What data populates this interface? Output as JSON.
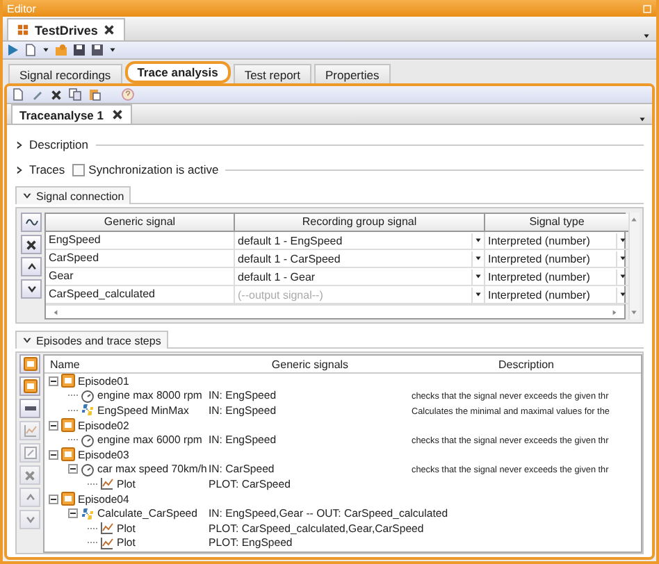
{
  "window": {
    "title": "Editor"
  },
  "document_tab": {
    "label": "TestDrives"
  },
  "main_tabs": [
    {
      "label": "Signal recordings",
      "selected": false
    },
    {
      "label": "Trace analysis",
      "selected": true
    },
    {
      "label": "Test report",
      "selected": false
    },
    {
      "label": "Properties",
      "selected": false
    }
  ],
  "analysis_tab": {
    "label": "Traceanalyse 1"
  },
  "description_section": {
    "label": "Description",
    "expanded": false
  },
  "traces_section": {
    "label": "Traces",
    "expanded": false,
    "sync_checkbox": {
      "label": "Synchronization is active",
      "checked": false
    }
  },
  "signal_connection": {
    "label": "Signal connection",
    "expanded": true,
    "columns": [
      "Generic signal",
      "Recording group signal",
      "Signal type"
    ],
    "rows": [
      {
        "generic": "EngSpeed",
        "recording": "default 1 - EngSpeed",
        "type": "Interpreted (number)"
      },
      {
        "generic": "CarSpeed",
        "recording": "default 1 - CarSpeed",
        "type": "Interpreted (number)"
      },
      {
        "generic": "Gear",
        "recording": "default 1 - Gear",
        "type": "Interpreted (number)"
      },
      {
        "generic": "CarSpeed_calculated",
        "placeholder": "(--output signal--)",
        "type": "Interpreted (number)"
      }
    ]
  },
  "episodes": {
    "label": "Episodes and trace steps",
    "expanded": true,
    "columns": [
      "Name",
      "Generic signals",
      "Description"
    ],
    "items": [
      {
        "kind": "episode",
        "name": "Episode01",
        "expanded": true,
        "children": [
          {
            "kind": "check",
            "name": "engine max 8000 rpm",
            "signals": "IN: EngSpeed",
            "description": "checks that the signal never exceeds the given thr"
          },
          {
            "kind": "script",
            "name": "EngSpeed MinMax",
            "signals": "IN: EngSpeed",
            "description": "Calculates the minimal and maximal values for the"
          }
        ]
      },
      {
        "kind": "episode",
        "name": "Episode02",
        "expanded": true,
        "children": [
          {
            "kind": "check",
            "name": "engine max 6000 rpm",
            "signals": "IN: EngSpeed",
            "description": "checks that the signal never exceeds the given thr"
          }
        ]
      },
      {
        "kind": "episode",
        "name": "Episode03",
        "expanded": true,
        "children": [
          {
            "kind": "check",
            "name": "car max speed 70km/h",
            "signals": "IN: CarSpeed",
            "description": "checks that the signal never exceeds the given thr",
            "expanded": true,
            "children": [
              {
                "kind": "plot",
                "name": "Plot",
                "signals": "PLOT: CarSpeed"
              }
            ]
          }
        ]
      },
      {
        "kind": "episode",
        "name": "Episode04",
        "expanded": true,
        "children": [
          {
            "kind": "script",
            "name": "Calculate_CarSpeed",
            "signals": "IN: EngSpeed,Gear -- OUT: CarSpeed_calculated",
            "expanded": true,
            "children": [
              {
                "kind": "plot",
                "name": "Plot",
                "signals": "PLOT: CarSpeed_calculated,Gear,CarSpeed"
              },
              {
                "kind": "plot",
                "name": "Plot",
                "signals": "PLOT: EngSpeed"
              }
            ]
          }
        ]
      }
    ]
  }
}
